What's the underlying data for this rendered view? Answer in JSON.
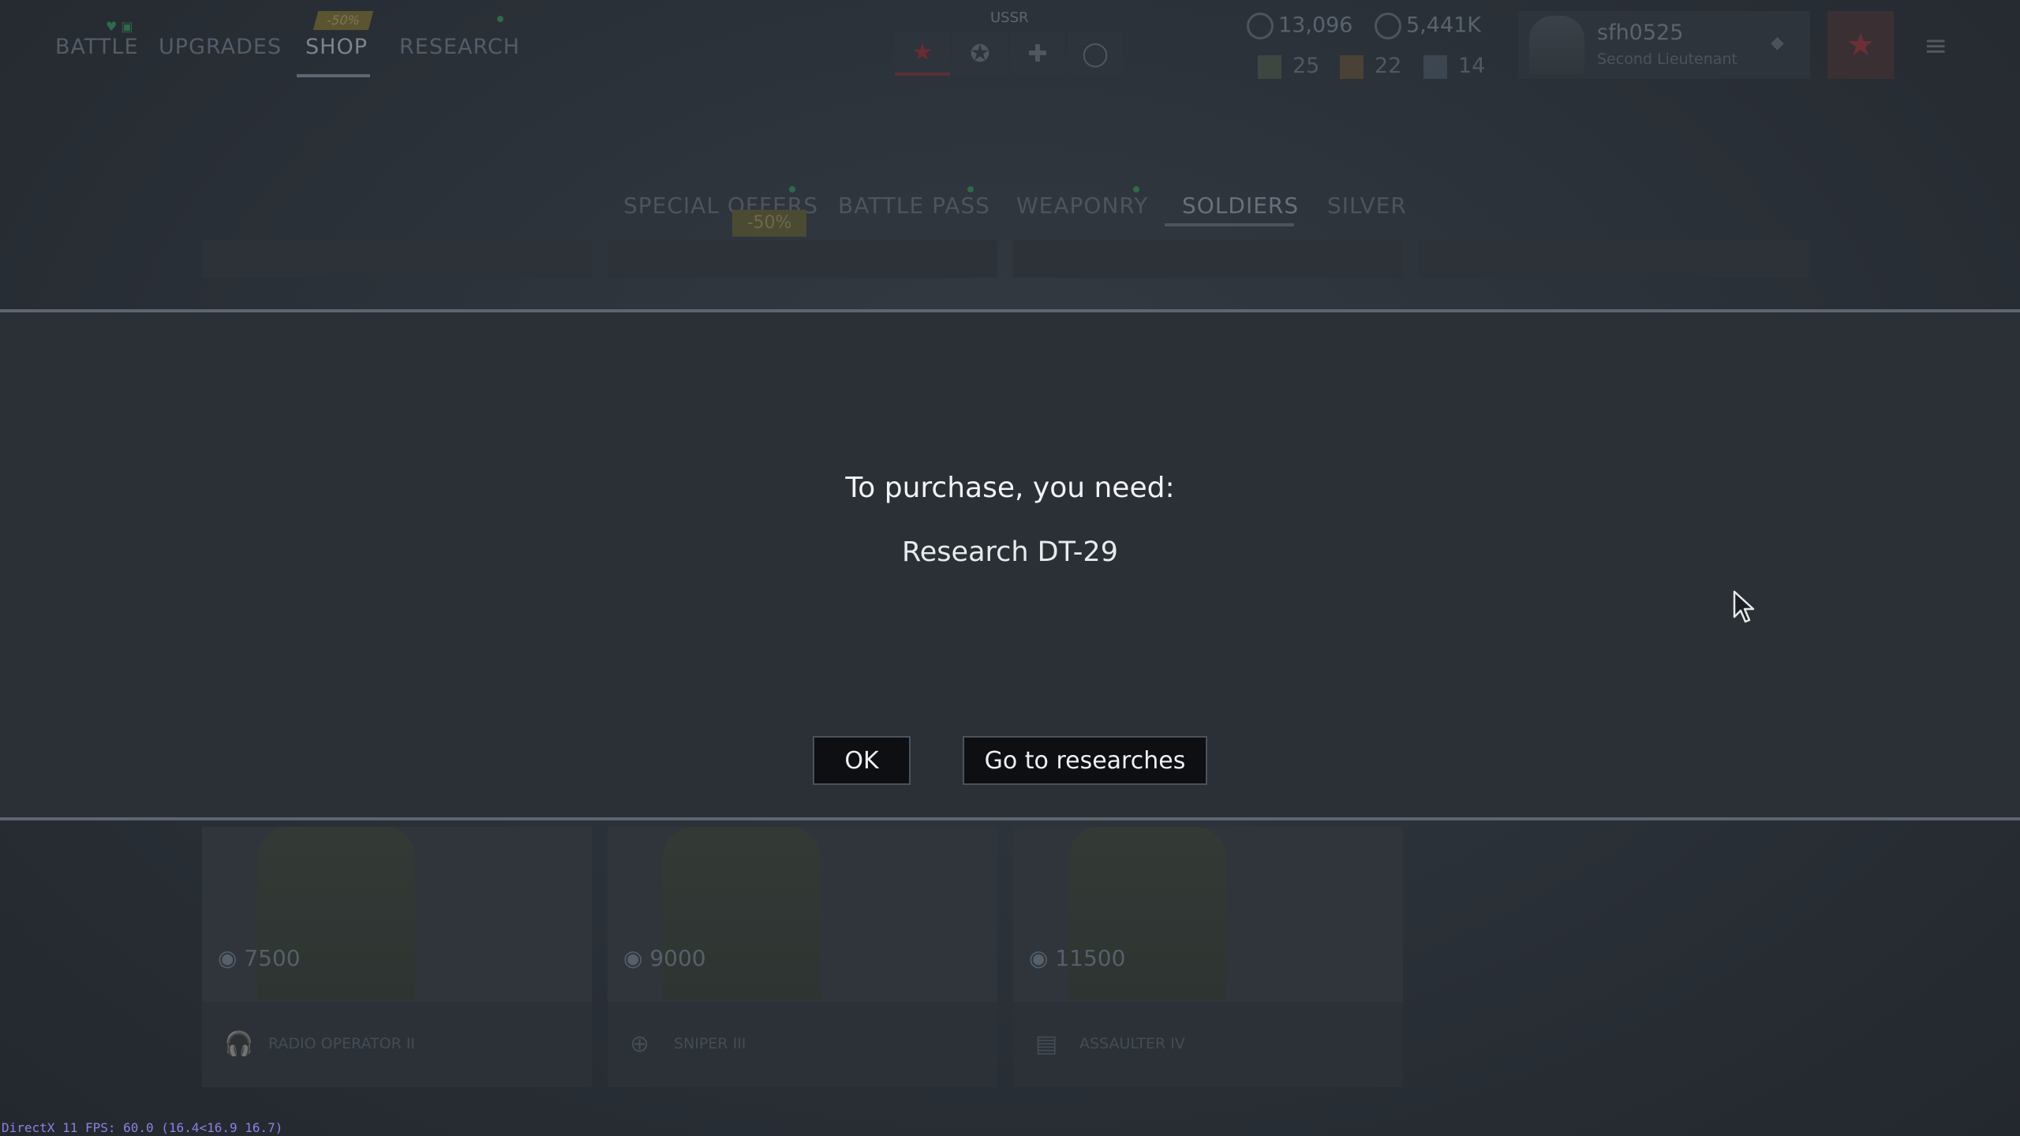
{
  "nav": {
    "battle": "BATTLE",
    "upgrades": "UPGRADES",
    "shop": "SHOP",
    "research": "RESEARCH",
    "shop_badge": "-50%",
    "battle_badge_icons": "♥ ▣"
  },
  "nation": {
    "label": "USSR"
  },
  "currencies": {
    "gold": "13,096",
    "silver": "5,441K"
  },
  "resources": {
    "first": "25",
    "second": "22",
    "third": "14"
  },
  "profile": {
    "name": "sfh0525",
    "rank": "Second Lieutenant"
  },
  "shop_tabs": {
    "special_offers": "SPECIAL OFFERS",
    "battle_pass": "BATTLE PASS",
    "weaponry": "WEAPONRY",
    "soldiers": "SOLDIERS",
    "silver": "SILVER",
    "sale_tag": "-50%"
  },
  "soldier_cards": [
    {
      "price": "7500",
      "label": "RADIO OPERATOR II"
    },
    {
      "price": "9000",
      "label": "SNIPER III"
    },
    {
      "price": "11500",
      "label": "ASSAULTER IV"
    }
  ],
  "modal": {
    "title": "To purchase, you need:",
    "requirement": "Research DT-29",
    "ok_label": "OK",
    "go_label": "Go to researches"
  },
  "debug": {
    "fps_text": "DirectX 11 FPS: 60.0 (16.4<16.9 16.7)"
  },
  "colors": {
    "background": "#272d33",
    "modal_band": "#2a3036",
    "modal_border": "#5d6670",
    "button_bg": "#0d0f12",
    "text_primary": "#f1f3f5",
    "fps_text": "#8f7fe0"
  }
}
